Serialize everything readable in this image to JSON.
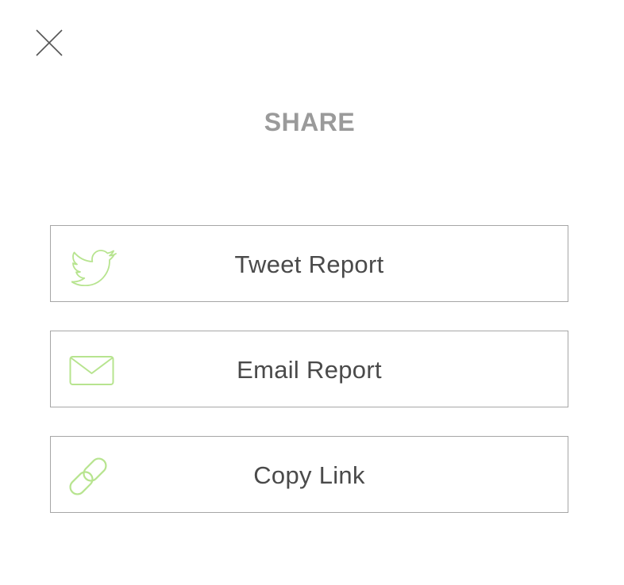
{
  "dialog": {
    "title": "SHARE",
    "close_icon": "close-icon"
  },
  "options": [
    {
      "label": "Tweet Report",
      "icon": "twitter-bird-icon"
    },
    {
      "label": "Email Report",
      "icon": "envelope-icon"
    },
    {
      "label": "Copy Link",
      "icon": "link-icon"
    }
  ],
  "colors": {
    "icon_accent": "#b7e48f",
    "title": "#9a9a9a",
    "label": "#4a4a4a",
    "border": "#a6a6a6"
  }
}
